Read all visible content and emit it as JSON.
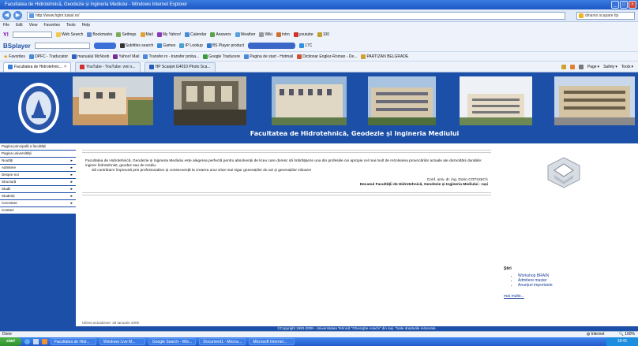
{
  "window": {
    "title": "Facultatea de Hidrotehnică, Geodezie și Ingineria Mediului - Windows Internet Explorer"
  },
  "address": {
    "url": "http://www.hgim.tuiasi.ro/",
    "search_placeholder": "dinamo scapare tip"
  },
  "menu": [
    "File",
    "Edit",
    "View",
    "Favorites",
    "Tools",
    "Help"
  ],
  "toolbar1": {
    "items": [
      "Web Search",
      "Bookmarks",
      "Settings",
      "Mail",
      "My Yahoo!",
      "Calendar",
      "Answers",
      "Weather",
      "Wiki",
      "Intro",
      "youtube",
      "100"
    ]
  },
  "toolbar2": {
    "brand": "BSplayer",
    "items": [
      "Subtitles search",
      "Games",
      "IP Lookup",
      "BS Player product",
      "17C"
    ]
  },
  "favorites": {
    "label": "Favorites",
    "items": [
      "OPFC - Traducator",
      "manualul McNoob",
      "Yahoo! Mail",
      "Transfer.ro - transfer proba...",
      "Google Traducere",
      "Pagina de start - Hotmail",
      "Dictionar Englez-Roman - De...",
      "PARTIZAN BELGRADE"
    ]
  },
  "tabs": [
    {
      "label": "Facultatea de Hidrotehnic...",
      "active": true
    },
    {
      "label": "YouTube - YouTube: vrei s...",
      "active": false
    },
    {
      "label": "HP Scanjet G4010 Photo Sca...",
      "active": false
    }
  ],
  "commandbar": [
    "Page",
    "Safety",
    "Tools"
  ],
  "site": {
    "title": "Facultatea de Hidrotehnică, Geodezie și Ingineria Mediului",
    "nav": [
      {
        "label": "Pagina principală a facultății",
        "arrow": false
      },
      {
        "label": "Pagina universității",
        "arrow": false
      },
      {
        "label": "Noutăți",
        "arrow": true
      },
      {
        "label": "Admitere",
        "arrow": true
      },
      {
        "label": "Despre noi",
        "arrow": true
      },
      {
        "label": "Structură",
        "arrow": true
      },
      {
        "label": "Studii",
        "arrow": true
      },
      {
        "label": "Studenți",
        "arrow": true
      },
      {
        "label": "Cercetare",
        "arrow": true
      },
      {
        "label": "Contact",
        "arrow": false
      }
    ],
    "intro_p1": "Facultatea de Hidrotehnică, Geodezie și Ingineria Mediului este alegerea perfectă pentru absolvenții de liceu care doresc să îmbrățișeze una din profesiile cei apropie cel mai mult de rezolvarea provocărilor actuale ale dezvoltării durabile: inginer hidrotehnist, geodez sau de mediu.",
    "intro_p2": "Să contribuim împreună prin profesionalism și consecvență la crearea unui viitor mai sigur generațiilor de azi și generațiilor viitoare!",
    "sig_name": "Conf. univ. dr. ing. Dorin COTIUȘCĂ",
    "sig_role": "Decanul Facultății de Hidrotehnică, Geodezie și Ingineria Mediului - Iași",
    "last_update": "Ultima actualizare: 28 Ianuarie 2009",
    "news_title": "Știri",
    "news": [
      "Workshop BRAIN",
      "Admitere master",
      "Anunțuri importante"
    ],
    "more_link": "mai multe...",
    "footer": "©Copyright 1993-2008 - Universitatea Tehnică \"Gheorghe Asachi\" din Iași. Toate drepturile rezervate."
  },
  "status": {
    "left": "Done",
    "zone": "Internet",
    "zoom": "100%"
  },
  "taskbar": {
    "start": "start",
    "tasks": [
      "Facultatea de Hidr...",
      "Windows Live M...",
      "Google Search - Win...",
      "Document1 - Micros...",
      "Microsoft Internet..."
    ],
    "clock": "18:41"
  },
  "colors": {
    "site_blue": "#1c4fa8",
    "titlebar_blue": "#2a63d0",
    "link": "#1a3d9a"
  }
}
